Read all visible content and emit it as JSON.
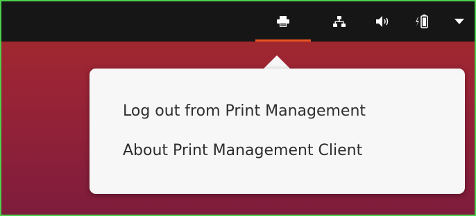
{
  "top_bar": {
    "indicators": [
      {
        "icon": "printer-icon",
        "active": true,
        "accent_color": "#e95420"
      },
      {
        "icon": "network-wired-icon"
      },
      {
        "icon": "volume-icon"
      },
      {
        "icon": "battery-charging-icon"
      },
      {
        "icon": "chevron-down-icon"
      }
    ]
  },
  "popover_menu": {
    "items": [
      {
        "label": "Log out from Print Management"
      },
      {
        "label": "About Print Management Client"
      }
    ]
  }
}
